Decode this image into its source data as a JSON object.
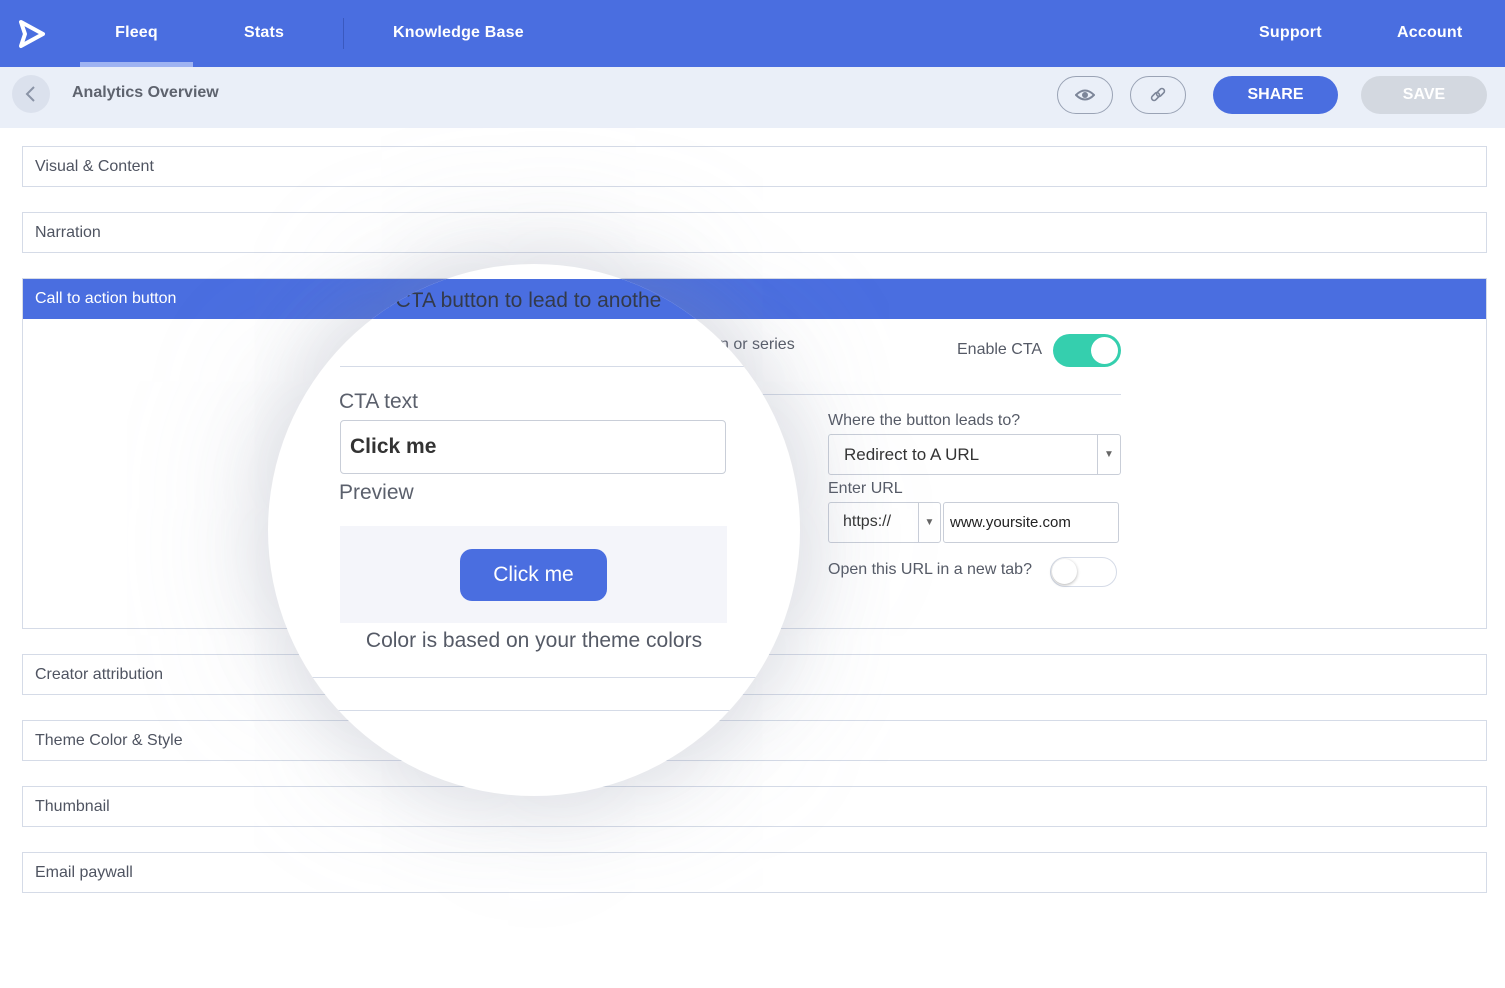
{
  "nav": {
    "items": [
      "Fleeq",
      "Stats",
      "Knowledge Base"
    ],
    "right": [
      "Support",
      "Account"
    ],
    "active": "Fleeq"
  },
  "subheader": {
    "title": "Analytics Overview",
    "share_label": "SHARE",
    "save_label": "SAVE"
  },
  "panels": {
    "visual": "Visual & Content",
    "narration": "Narration",
    "cta": "Call to action button",
    "creator": "Creator attribution",
    "theme": "Theme Color & Style",
    "thumbnail": "Thumbnail",
    "email": "Email paywall"
  },
  "cta_settings": {
    "description_fragment": "n or series",
    "enable_label": "Enable CTA",
    "enabled": true,
    "leads_label": "Where the button leads to?",
    "leads_value": "Redirect to A URL",
    "url_label": "Enter URL",
    "protocol": "https://",
    "url_value": "www.yoursite.com",
    "new_tab_label": "Open this URL in a new tab?",
    "new_tab": false
  },
  "magnifier": {
    "header_fragment": "a CTA button to lead to anothe",
    "cta_text_label": "CTA text",
    "cta_text_value": "Click me",
    "preview_label": "Preview",
    "preview_button": "Click me",
    "note": "Color is based on your theme colors"
  },
  "colors": {
    "primary": "#4a6ee0",
    "toggle_on": "#35cfae",
    "save_disabled": "#d3d8e0"
  }
}
